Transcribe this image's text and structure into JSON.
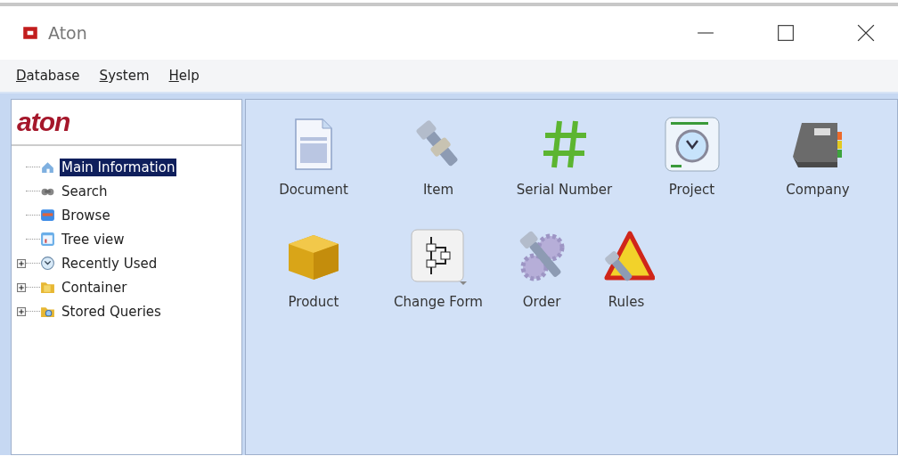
{
  "window": {
    "title": "Aton"
  },
  "menu": [
    {
      "label": "Database"
    },
    {
      "label": "System"
    },
    {
      "label": "Help"
    }
  ],
  "sidebar": {
    "logo": "aton",
    "items": [
      {
        "label": "Main Information",
        "selected": true,
        "kind": "leaf"
      },
      {
        "label": "Search",
        "selected": false,
        "kind": "leaf"
      },
      {
        "label": "Browse",
        "selected": false,
        "kind": "leaf"
      },
      {
        "label": "Tree view",
        "selected": false,
        "kind": "leaf"
      },
      {
        "label": "Recently Used",
        "selected": false,
        "kind": "folder"
      },
      {
        "label": "Container",
        "selected": false,
        "kind": "folder"
      },
      {
        "label": "Stored Queries",
        "selected": false,
        "kind": "folder"
      }
    ]
  },
  "launcher": {
    "rows": [
      [
        {
          "label": "Document",
          "kind": "document"
        },
        {
          "label": "Item",
          "kind": "bolt"
        },
        {
          "label": "Serial Number",
          "kind": "hash"
        },
        {
          "label": "Project",
          "kind": "clock"
        },
        {
          "label": "Company",
          "kind": "book"
        }
      ],
      [
        {
          "label": "Product",
          "kind": "box"
        },
        {
          "label": "Change Form",
          "kind": "flow"
        },
        {
          "label": "Order",
          "kind": "gears"
        },
        {
          "label": "Rules",
          "kind": "warning"
        }
      ]
    ]
  }
}
